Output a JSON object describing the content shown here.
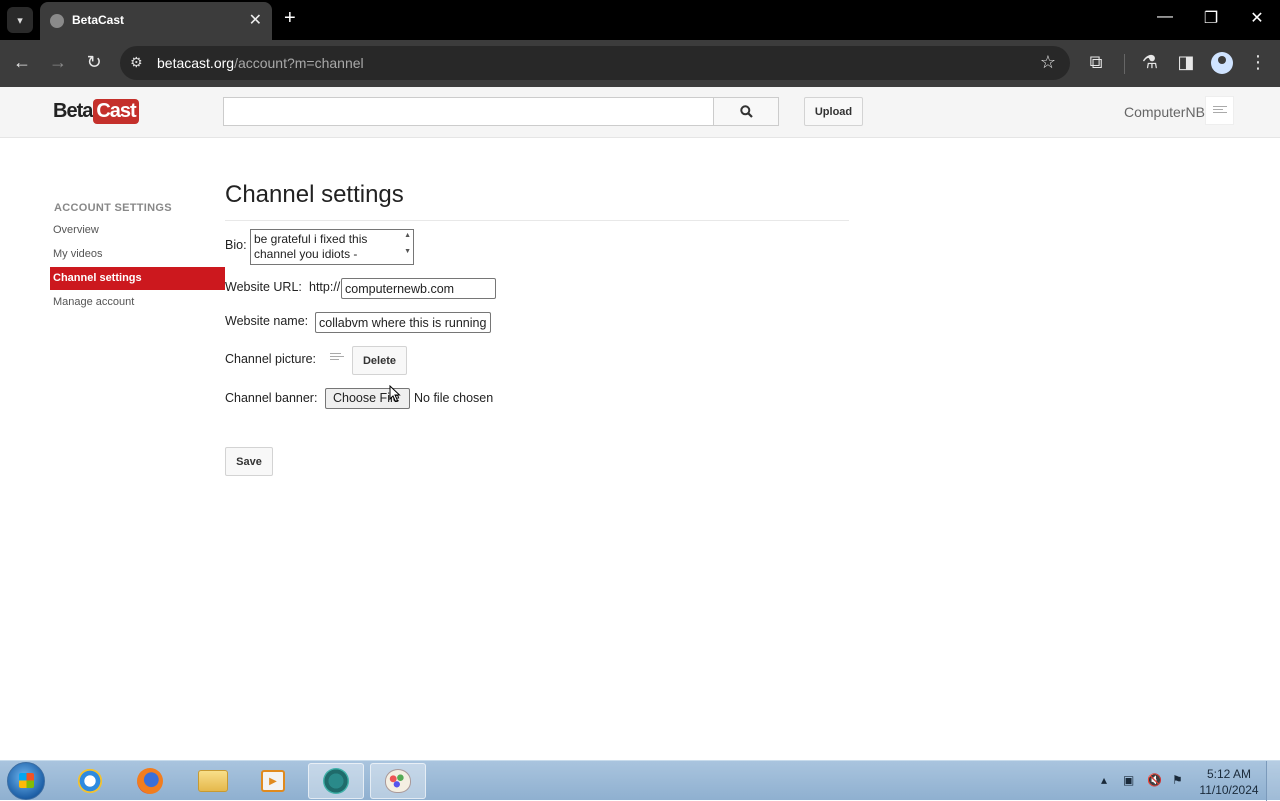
{
  "browser": {
    "tab_title": "BetaCast",
    "url_domain": "betacast.org",
    "url_path": "/account?m=channel"
  },
  "site": {
    "logo_beta": "Beta",
    "logo_cast": "Cast",
    "search_placeholder": "",
    "upload_label": "Upload",
    "username": "ComputerNB"
  },
  "sidebar": {
    "heading": "ACCOUNT SETTINGS",
    "items": [
      {
        "label": "Overview",
        "active": false
      },
      {
        "label": "My videos",
        "active": false
      },
      {
        "label": "Channel settings",
        "active": true
      },
      {
        "label": "Manage account",
        "active": false
      }
    ]
  },
  "form": {
    "title": "Channel settings",
    "bio_label": "Bio:",
    "bio_value": "be grateful i fixed this channel you idiots -",
    "website_url_label": "Website URL:",
    "website_url_prefix": "http://",
    "website_url_value": "computernewb.com",
    "website_name_label": "Website name:",
    "website_name_value": "collabvm where this is running",
    "channel_picture_label": "Channel picture:",
    "delete_label": "Delete",
    "channel_banner_label": "Channel banner:",
    "choose_file_label": "Choose File",
    "no_file_text": "No file chosen",
    "save_label": "Save"
  },
  "taskbar": {
    "time": "5:12 AM",
    "date": "11/10/2024"
  },
  "colors": {
    "accent_red": "#cc181e",
    "browser_dark": "#3c3c3c",
    "taskbar_blue": "#9fbcd8"
  }
}
